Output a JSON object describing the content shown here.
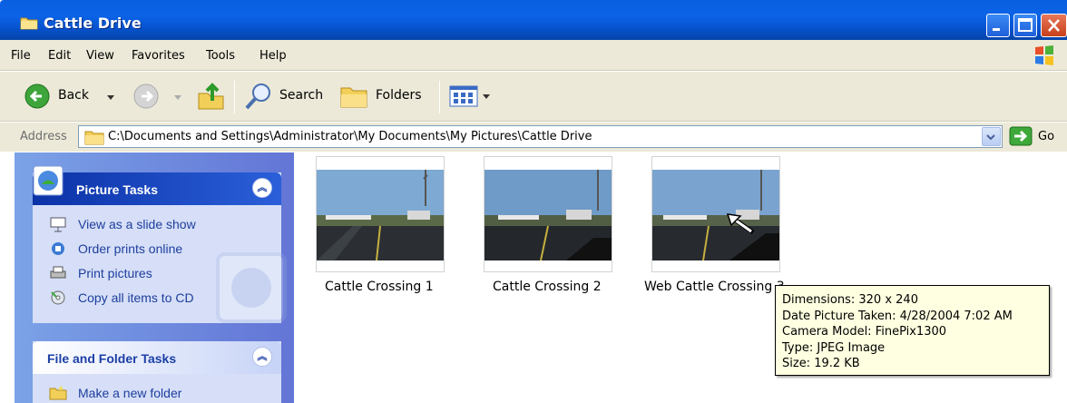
{
  "window": {
    "title": "Cattle Drive"
  },
  "menu": [
    "File",
    "Edit",
    "View",
    "Favorites",
    "Tools",
    "Help"
  ],
  "toolbar": {
    "back_label": "Back",
    "search_label": "Search",
    "folders_label": "Folders"
  },
  "address": {
    "label": "Address",
    "path": "C:\\Documents and Settings\\Administrator\\My Documents\\My Pictures\\Cattle Drive",
    "go_label": "Go"
  },
  "picture_tasks": {
    "title": "Picture Tasks",
    "items": [
      "View as a slide show",
      "Order prints online",
      "Print pictures",
      "Copy all items to CD"
    ]
  },
  "file_tasks": {
    "title": "File and Folder Tasks",
    "items": [
      "Make a new folder"
    ]
  },
  "files": [
    {
      "name": "Cattle Crossing 1"
    },
    {
      "name": "Cattle Crossing 2"
    },
    {
      "name": "Web Cattle Crossing 3"
    }
  ],
  "tooltip": {
    "dimensions": "Dimensions: 320 x 240",
    "date_taken": "Date Picture Taken: 4/28/2004 7:02 AM",
    "camera": "Camera Model: FinePix1300",
    "type": "Type: JPEG Image",
    "size": "Size: 19.2 KB"
  }
}
